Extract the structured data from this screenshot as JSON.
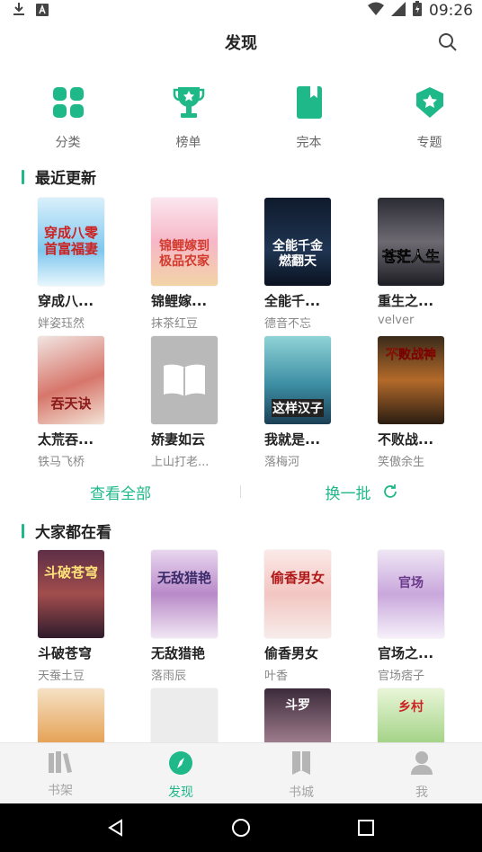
{
  "status_bar": {
    "time": "09:26",
    "download_icon": "download-icon",
    "notification_icon": "a-notification-icon",
    "wifi_icon": "wifi-icon",
    "battery_icon": "battery-icon"
  },
  "header": {
    "title": "发现",
    "search_icon": "search-icon"
  },
  "quick_nav": [
    {
      "label": "分类",
      "icon": "category-grid-icon"
    },
    {
      "label": "榜单",
      "icon": "trophy-icon"
    },
    {
      "label": "完本",
      "icon": "bookmark-book-icon"
    },
    {
      "label": "专题",
      "icon": "star-badge-icon"
    }
  ],
  "recent": {
    "title": "最近更新",
    "books": [
      {
        "title": "穿成八...",
        "author": "姅姿珏然",
        "cover_text": "穿成八零 首富福妻"
      },
      {
        "title": "锦鲤嫁...",
        "author": "抹茶红豆",
        "cover_text": "锦鲤嫁到 极品农家"
      },
      {
        "title": "全能千...",
        "author": "德音不忘",
        "cover_text": "全能千金 燃翻天"
      },
      {
        "title": "重生之...",
        "author": "velver",
        "cover_text": "苍茫人生"
      },
      {
        "title": "太荒吞...",
        "author": "铁马飞桥",
        "cover_text": "吞天诀"
      },
      {
        "title": "娇妻如云",
        "author": "上山打老...",
        "cover_text": ""
      },
      {
        "title": "我就是...",
        "author": "落梅河",
        "cover_text": "这样汉子"
      },
      {
        "title": "不败战...",
        "author": "笑傲余生",
        "cover_text": "不败战神"
      }
    ],
    "view_all": "查看全部",
    "refresh": "换一批"
  },
  "popular": {
    "title": "大家都在看",
    "books": [
      {
        "title": "斗破苍穹",
        "author": "天蚕土豆",
        "cover_text": "斗破苍穹"
      },
      {
        "title": "无敌猎艳",
        "author": "落雨辰",
        "cover_text": "无敌猎艳"
      },
      {
        "title": "偷香男女",
        "author": "叶香",
        "cover_text": "偷香男女"
      },
      {
        "title": "官场之...",
        "author": "官场痞子",
        "cover_text": "官场"
      }
    ],
    "more_covers": [
      "",
      "",
      "斗罗",
      "乡村"
    ]
  },
  "bottom_nav": [
    {
      "label": "书架",
      "icon": "bookshelf-icon",
      "active": false
    },
    {
      "label": "发现",
      "icon": "compass-icon",
      "active": true
    },
    {
      "label": "书城",
      "icon": "book-store-icon",
      "active": false
    },
    {
      "label": "我",
      "icon": "person-icon",
      "active": false
    }
  ],
  "colors": {
    "accent": "#1fb889",
    "inactive": "#a5a5a5",
    "system_nav": "#000000"
  }
}
